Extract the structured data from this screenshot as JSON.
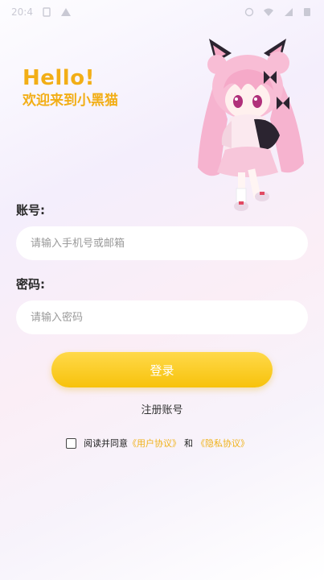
{
  "status_bar": {
    "time": "20:4",
    "icons": [
      "sim-icon",
      "warning-icon",
      "signal-icon",
      "wifi-icon",
      "battery-icon"
    ]
  },
  "greeting": {
    "hello": "Hello!",
    "welcome": "欢迎来到小黑猫"
  },
  "form": {
    "account_label": "账号:",
    "account_placeholder": "请输入手机号或邮箱",
    "password_label": "密码:",
    "password_placeholder": "请输入密码",
    "login_label": "登录",
    "register_label": "注册账号"
  },
  "agreement": {
    "prefix": "阅读并同意",
    "user_agreement": "《用户协议》",
    "conjunction": "和",
    "privacy_policy": "《隐私协议》"
  },
  "colors": {
    "accent": "#f2ae16",
    "button": "#f7c20b",
    "link": "#f0b21a"
  }
}
